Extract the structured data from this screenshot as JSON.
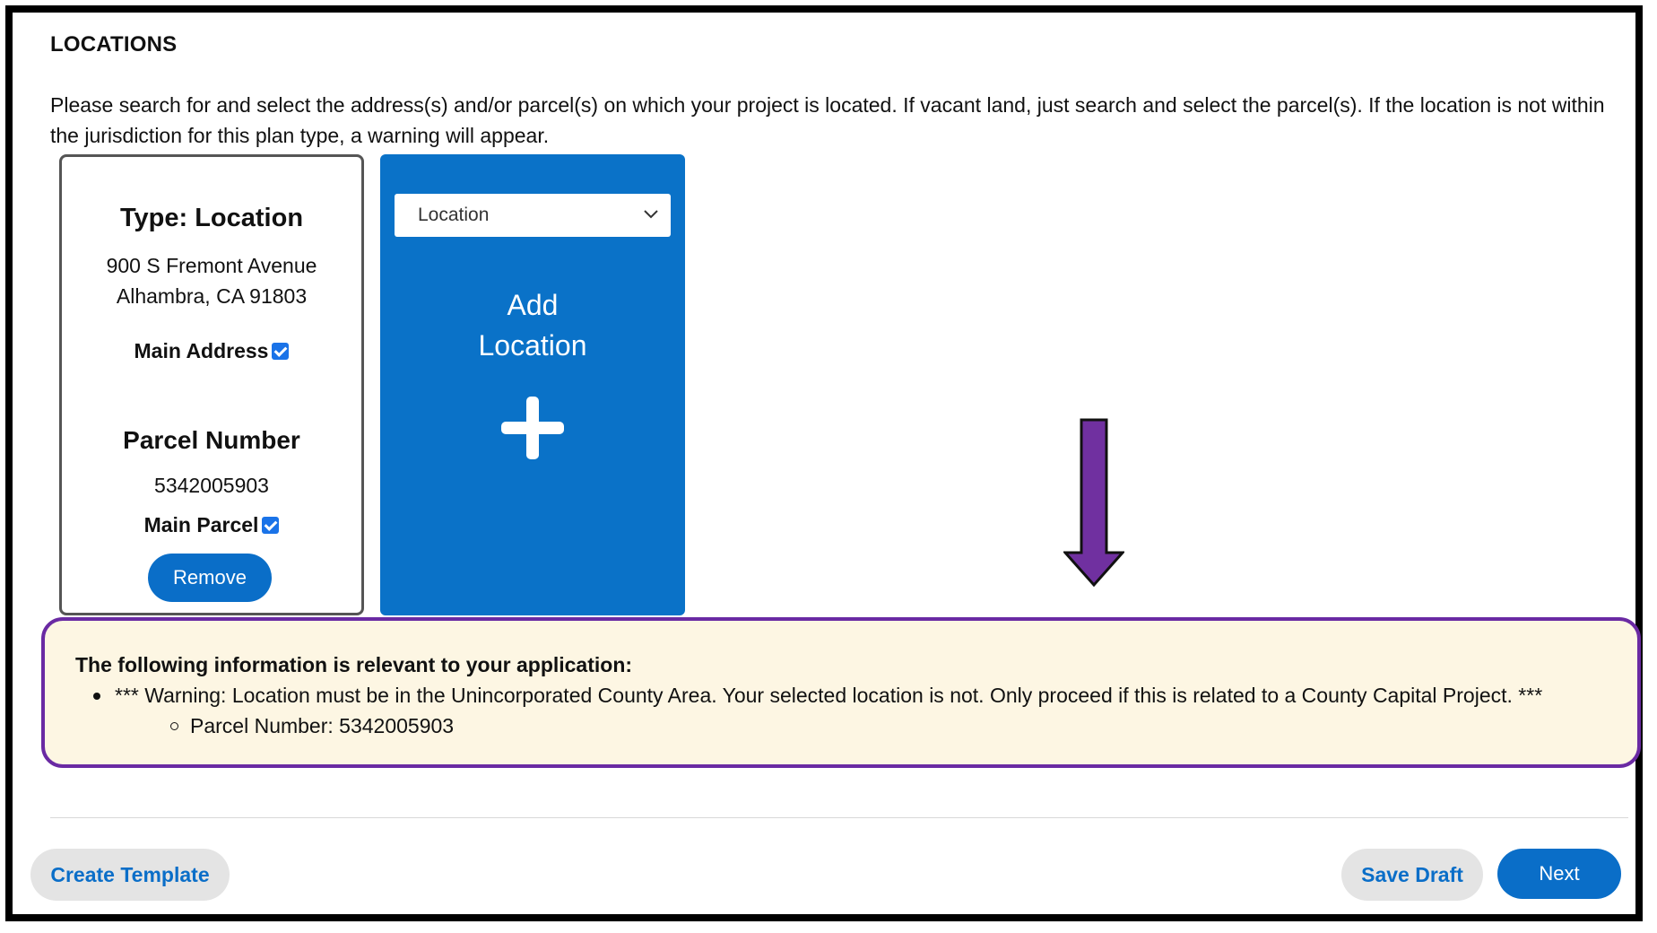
{
  "section": {
    "title": "LOCATIONS",
    "intro": "Please search for and select the address(s) and/or parcel(s) on which your project is located. If vacant land, just search and select the parcel(s). If the location is not within the jurisdiction for this plan type, a warning will appear."
  },
  "location_card": {
    "type_label": "Type: Location",
    "address_line1": "900 S Fremont Avenue",
    "address_line2": "Alhambra, CA 91803",
    "main_address_label": "Main Address",
    "main_address_checked": true,
    "parcel_heading": "Parcel Number",
    "parcel_value": "5342005903",
    "main_parcel_label": "Main Parcel",
    "main_parcel_checked": true,
    "remove_label": "Remove"
  },
  "add_card": {
    "select_value": "Location",
    "add_label_line1": "Add",
    "add_label_line2": "Location",
    "icon": "plus-icon"
  },
  "notice": {
    "heading": "The following information is relevant to your application:",
    "warning": "*** Warning: Location must be in the Unincorporated County Area. Your selected location is not. Only proceed if this is related to a County Capital Project. ***",
    "detail": "Parcel Number: 5342005903",
    "border_color": "#6a2aa3",
    "background": "#fdf6e3"
  },
  "annotation": {
    "icon": "arrow-down-icon",
    "color": "#7030a0"
  },
  "footer": {
    "create_template_label": "Create Template",
    "save_draft_label": "Save Draft",
    "next_label": "Next"
  },
  "colors": {
    "primary": "#0a6ec8",
    "secondary_button_bg": "#e4e4e4"
  }
}
